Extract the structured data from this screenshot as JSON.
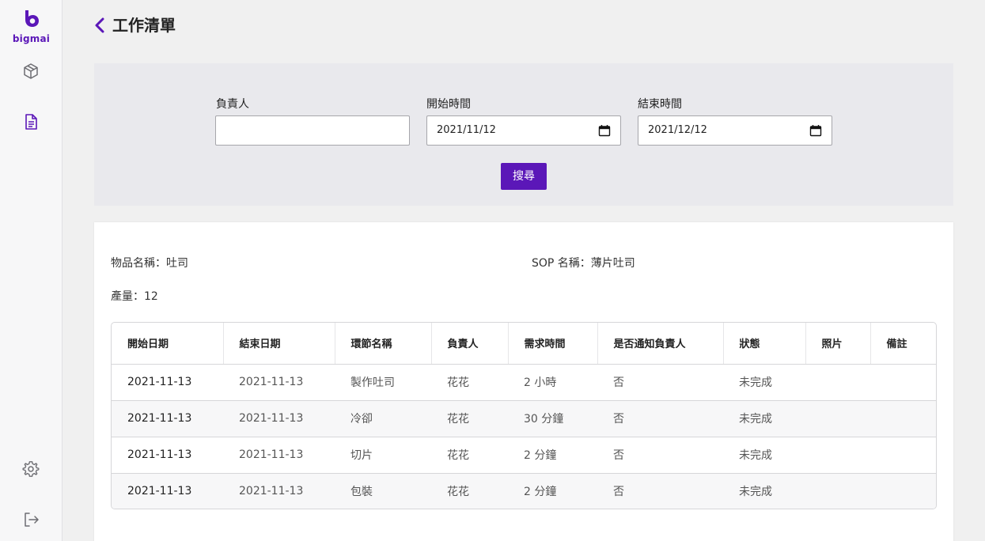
{
  "brand": {
    "logo_text": "bigmai",
    "accent": "#5b17b8"
  },
  "sidebar": {
    "items": [
      {
        "icon": "box-icon"
      },
      {
        "icon": "document-icon"
      },
      {
        "icon": "gear-icon"
      },
      {
        "icon": "logout-icon"
      }
    ]
  },
  "header": {
    "title": "工作清單"
  },
  "filters": {
    "owner_label": "負責人",
    "owner_value": "",
    "start_label": "開始時間",
    "start_value": "2021/11/12",
    "end_label": "結束時間",
    "end_value": "2021/12/12",
    "search_label": "搜尋"
  },
  "info": {
    "item_name": "物品名稱：吐司",
    "sop_name": "SOP 名稱：薄片吐司",
    "quantity": "產量：12"
  },
  "table": {
    "columns": [
      "開始日期",
      "結束日期",
      "環節名稱",
      "負責人",
      "需求時間",
      "是否通知負責人",
      "狀態",
      "照片",
      "備註"
    ],
    "rows": [
      [
        "2021-11-13",
        "2021-11-13",
        "製作吐司",
        "花花",
        "2 小時",
        "否",
        "未完成",
        "",
        ""
      ],
      [
        "2021-11-13",
        "2021-11-13",
        "冷卻",
        "花花",
        "30 分鐘",
        "否",
        "未完成",
        "",
        ""
      ],
      [
        "2021-11-13",
        "2021-11-13",
        "切片",
        "花花",
        "2 分鐘",
        "否",
        "未完成",
        "",
        ""
      ],
      [
        "2021-11-13",
        "2021-11-13",
        "包裝",
        "花花",
        "2 分鐘",
        "否",
        "未完成",
        "",
        ""
      ]
    ]
  }
}
